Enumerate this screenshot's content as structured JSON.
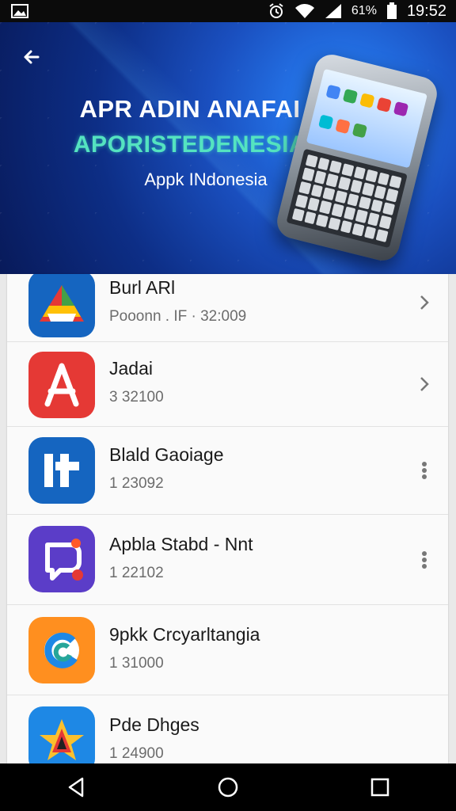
{
  "status_bar": {
    "time": "19:52",
    "battery_text": "61%",
    "icons": [
      "gallery-icon",
      "alarm-icon",
      "wifi-icon",
      "signal-icon",
      "battery-icon"
    ]
  },
  "header": {
    "title": "APR ADIN ANAFAI",
    "subtitle": "APORISTEDENESIA",
    "caption": "Appk INdonesia",
    "colors": {
      "subtitle": "#54e3c0",
      "background": "#1a4fbf"
    }
  },
  "apps": [
    {
      "name": "Burl ARl",
      "meta": "Pooonn . IF · 32:009",
      "icon": "drive-triangle-icon",
      "icon_bg": "#1565c0",
      "trailing": "chevron-right-icon"
    },
    {
      "name": "Jadai",
      "meta": "3 32100",
      "icon": "letter-a-icon",
      "icon_bg": "#e53935",
      "trailing": "chevron-right-icon"
    },
    {
      "name": "Blald Gaoiage",
      "meta": "1 23092",
      "icon": "letters-it-icon",
      "icon_bg": "#1565c0",
      "trailing": "more-vert-icon"
    },
    {
      "name": "Apbla Stabd - Nnt",
      "meta": "1 22102",
      "icon": "chat-bubble-icon",
      "icon_bg": "#5b3dc8",
      "trailing": "more-vert-icon"
    },
    {
      "name": "9pkk Crcyarltangia",
      "meta": "1 31000",
      "icon": "swirl-c-icon",
      "icon_bg": "#ff8f1f",
      "trailing": ""
    },
    {
      "name": "Pde Dhges",
      "meta": "1 24900",
      "icon": "star-shape-icon",
      "icon_bg": "#1e88e5",
      "trailing": ""
    }
  ],
  "navbar": {
    "icons": [
      "back-triangle-icon",
      "home-circle-icon",
      "recents-square-icon"
    ]
  }
}
